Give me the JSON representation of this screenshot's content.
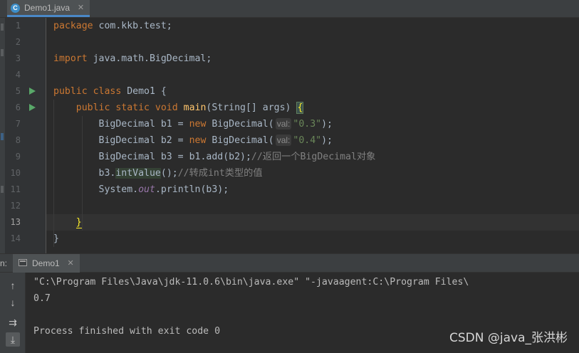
{
  "editor_tab": {
    "label": "Demo1.java",
    "icon": "class-c-icon",
    "close": "✕"
  },
  "gutter": {
    "line_numbers": [
      "1",
      "2",
      "3",
      "4",
      "5",
      "6",
      "7",
      "8",
      "9",
      "10",
      "11",
      "12",
      "13",
      "14"
    ],
    "current_line": 13
  },
  "code": {
    "l1": {
      "kw": "package",
      "rest": " com.kkb.test;"
    },
    "l3": {
      "kw": "import",
      "rest": " java.math.BigDecimal;"
    },
    "l5": {
      "kw": "public class",
      "rest": " Demo1 {"
    },
    "l6": {
      "indent": "    ",
      "kw": "public static void",
      "fn": " main",
      "rest": "(String[] args) ",
      "brace": "{"
    },
    "l7": {
      "indent": "        ",
      "pre": "BigDecimal b1 = ",
      "kw": "new",
      "mid": " BigDecimal(",
      "hint": "val:",
      "str": "\"0.3\"",
      "end": ");"
    },
    "l8": {
      "indent": "        ",
      "pre": "BigDecimal b2 = ",
      "kw": "new",
      "mid": " BigDecimal(",
      "hint": "val:",
      "str": "\"0.4\"",
      "end": ");"
    },
    "l9": {
      "indent": "        ",
      "pre": "BigDecimal b3 = b1.add(b2);",
      "comment": "//返回一个BigDecimal对象"
    },
    "l10": {
      "indent": "        ",
      "pre": "b3.",
      "usage": "intValue",
      "mid": "();",
      "comment": "//转成int类型的值"
    },
    "l11": {
      "indent": "        ",
      "pre": "System.",
      "static": "out",
      "rest": ".println(b3);"
    },
    "l13": {
      "indent": "    ",
      "brace": "}"
    },
    "l14": {
      "brace": "}"
    }
  },
  "run_window": {
    "prefix": "n:",
    "tab_label": "Demo1",
    "tab_close": "✕",
    "tools": [
      {
        "name": "up-arrow-icon",
        "glyph": "↑"
      },
      {
        "name": "down-arrow-icon",
        "glyph": "↓"
      },
      {
        "name": "soft-wrap-icon",
        "glyph": "⇉"
      },
      {
        "name": "scroll-to-end-icon",
        "glyph": "⤓"
      }
    ],
    "console_lines": [
      "\"C:\\Program Files\\Java\\jdk-11.0.6\\bin\\java.exe\" \"-javaagent:C:\\Program Files\\",
      "0.7",
      "",
      "Process finished with exit code 0"
    ]
  },
  "watermark": "CSDN @java_张洪彬",
  "colors": {
    "keyword": "#cc7832",
    "function": "#ffc66d",
    "string": "#6a8759",
    "comment": "#808080",
    "run_icon": "#59a869"
  }
}
